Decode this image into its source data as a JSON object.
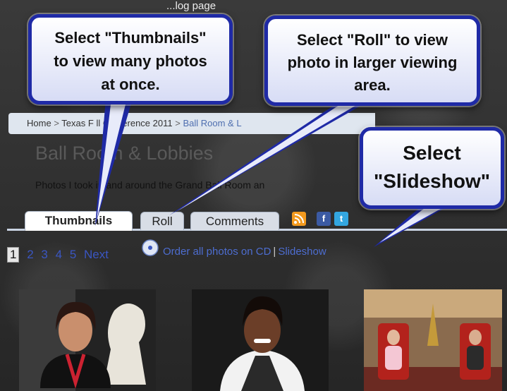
{
  "header": {
    "title": "...log page"
  },
  "breadcrumb": {
    "items": [
      "Home",
      "Texas F",
      "ll Conference 2011",
      "Ball Room & L"
    ],
    "separator": ">"
  },
  "gallery": {
    "title": "Ball Room & Lobbies",
    "description": "Photos I took in and around the Grand Ball Room an"
  },
  "tabs": [
    {
      "label": "Thumbnails",
      "active": true
    },
    {
      "label": "Roll",
      "active": false
    },
    {
      "label": "Comments",
      "active": false
    }
  ],
  "share_icons": [
    {
      "icon": "rss-icon",
      "glyph": "",
      "color": "#f39a1e"
    },
    {
      "icon": "facebook-icon",
      "glyph": "f",
      "color": "#3b5aa3"
    },
    {
      "icon": "twitter-icon",
      "glyph": "t",
      "color": "#33a6e0"
    }
  ],
  "pager": {
    "pages": [
      "1",
      "2",
      "3",
      "4",
      "5"
    ],
    "next": "Next",
    "current": "1"
  },
  "order": {
    "label": "Order all photos on CD",
    "separator": "|",
    "slideshow": "Slideshow"
  },
  "callouts": {
    "thumbnails": [
      "Select \"Thumbnails\"",
      "to view many photos",
      "at once."
    ],
    "roll": [
      "Select \"Roll\" to view",
      "photo in larger viewing",
      "area."
    ],
    "slideshow": [
      "Select",
      "\"Slideshow\""
    ]
  },
  "colors": {
    "callout_border": "#1f2aa6",
    "link": "#3a56c2",
    "breadcrumb_bg": "#dfe6ef"
  }
}
